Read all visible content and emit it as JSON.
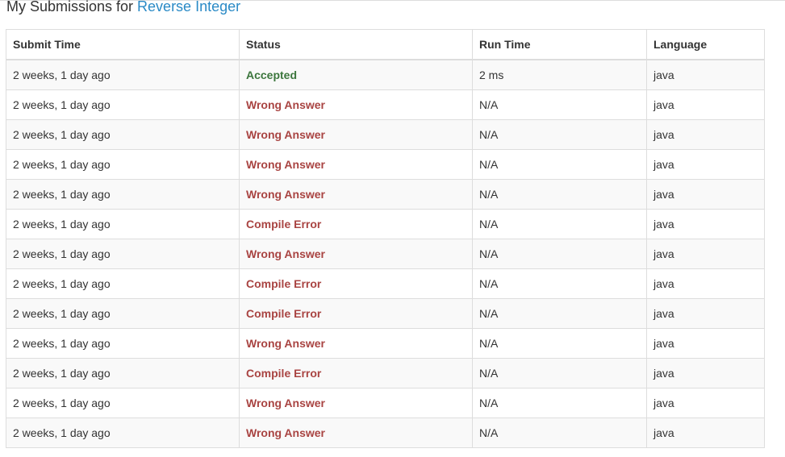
{
  "heading": {
    "prefix": "My Submissions for ",
    "problem": "Reverse Integer"
  },
  "table": {
    "columns": [
      "Submit Time",
      "Status",
      "Run Time",
      "Language"
    ],
    "rows": [
      {
        "time": "2 weeks, 1 day ago",
        "status": "Accepted",
        "runtime": "2 ms",
        "language": "java"
      },
      {
        "time": "2 weeks, 1 day ago",
        "status": "Wrong Answer",
        "runtime": "N/A",
        "language": "java"
      },
      {
        "time": "2 weeks, 1 day ago",
        "status": "Wrong Answer",
        "runtime": "N/A",
        "language": "java"
      },
      {
        "time": "2 weeks, 1 day ago",
        "status": "Wrong Answer",
        "runtime": "N/A",
        "language": "java"
      },
      {
        "time": "2 weeks, 1 day ago",
        "status": "Wrong Answer",
        "runtime": "N/A",
        "language": "java"
      },
      {
        "time": "2 weeks, 1 day ago",
        "status": "Compile Error",
        "runtime": "N/A",
        "language": "java"
      },
      {
        "time": "2 weeks, 1 day ago",
        "status": "Wrong Answer",
        "runtime": "N/A",
        "language": "java"
      },
      {
        "time": "2 weeks, 1 day ago",
        "status": "Compile Error",
        "runtime": "N/A",
        "language": "java"
      },
      {
        "time": "2 weeks, 1 day ago",
        "status": "Compile Error",
        "runtime": "N/A",
        "language": "java"
      },
      {
        "time": "2 weeks, 1 day ago",
        "status": "Wrong Answer",
        "runtime": "N/A",
        "language": "java"
      },
      {
        "time": "2 weeks, 1 day ago",
        "status": "Compile Error",
        "runtime": "N/A",
        "language": "java"
      },
      {
        "time": "2 weeks, 1 day ago",
        "status": "Wrong Answer",
        "runtime": "N/A",
        "language": "java"
      },
      {
        "time": "2 weeks, 1 day ago",
        "status": "Wrong Answer",
        "runtime": "N/A",
        "language": "java"
      }
    ]
  },
  "colors": {
    "accepted": "#3c763d",
    "failed": "#a94442",
    "link": "#2a8ac6"
  }
}
